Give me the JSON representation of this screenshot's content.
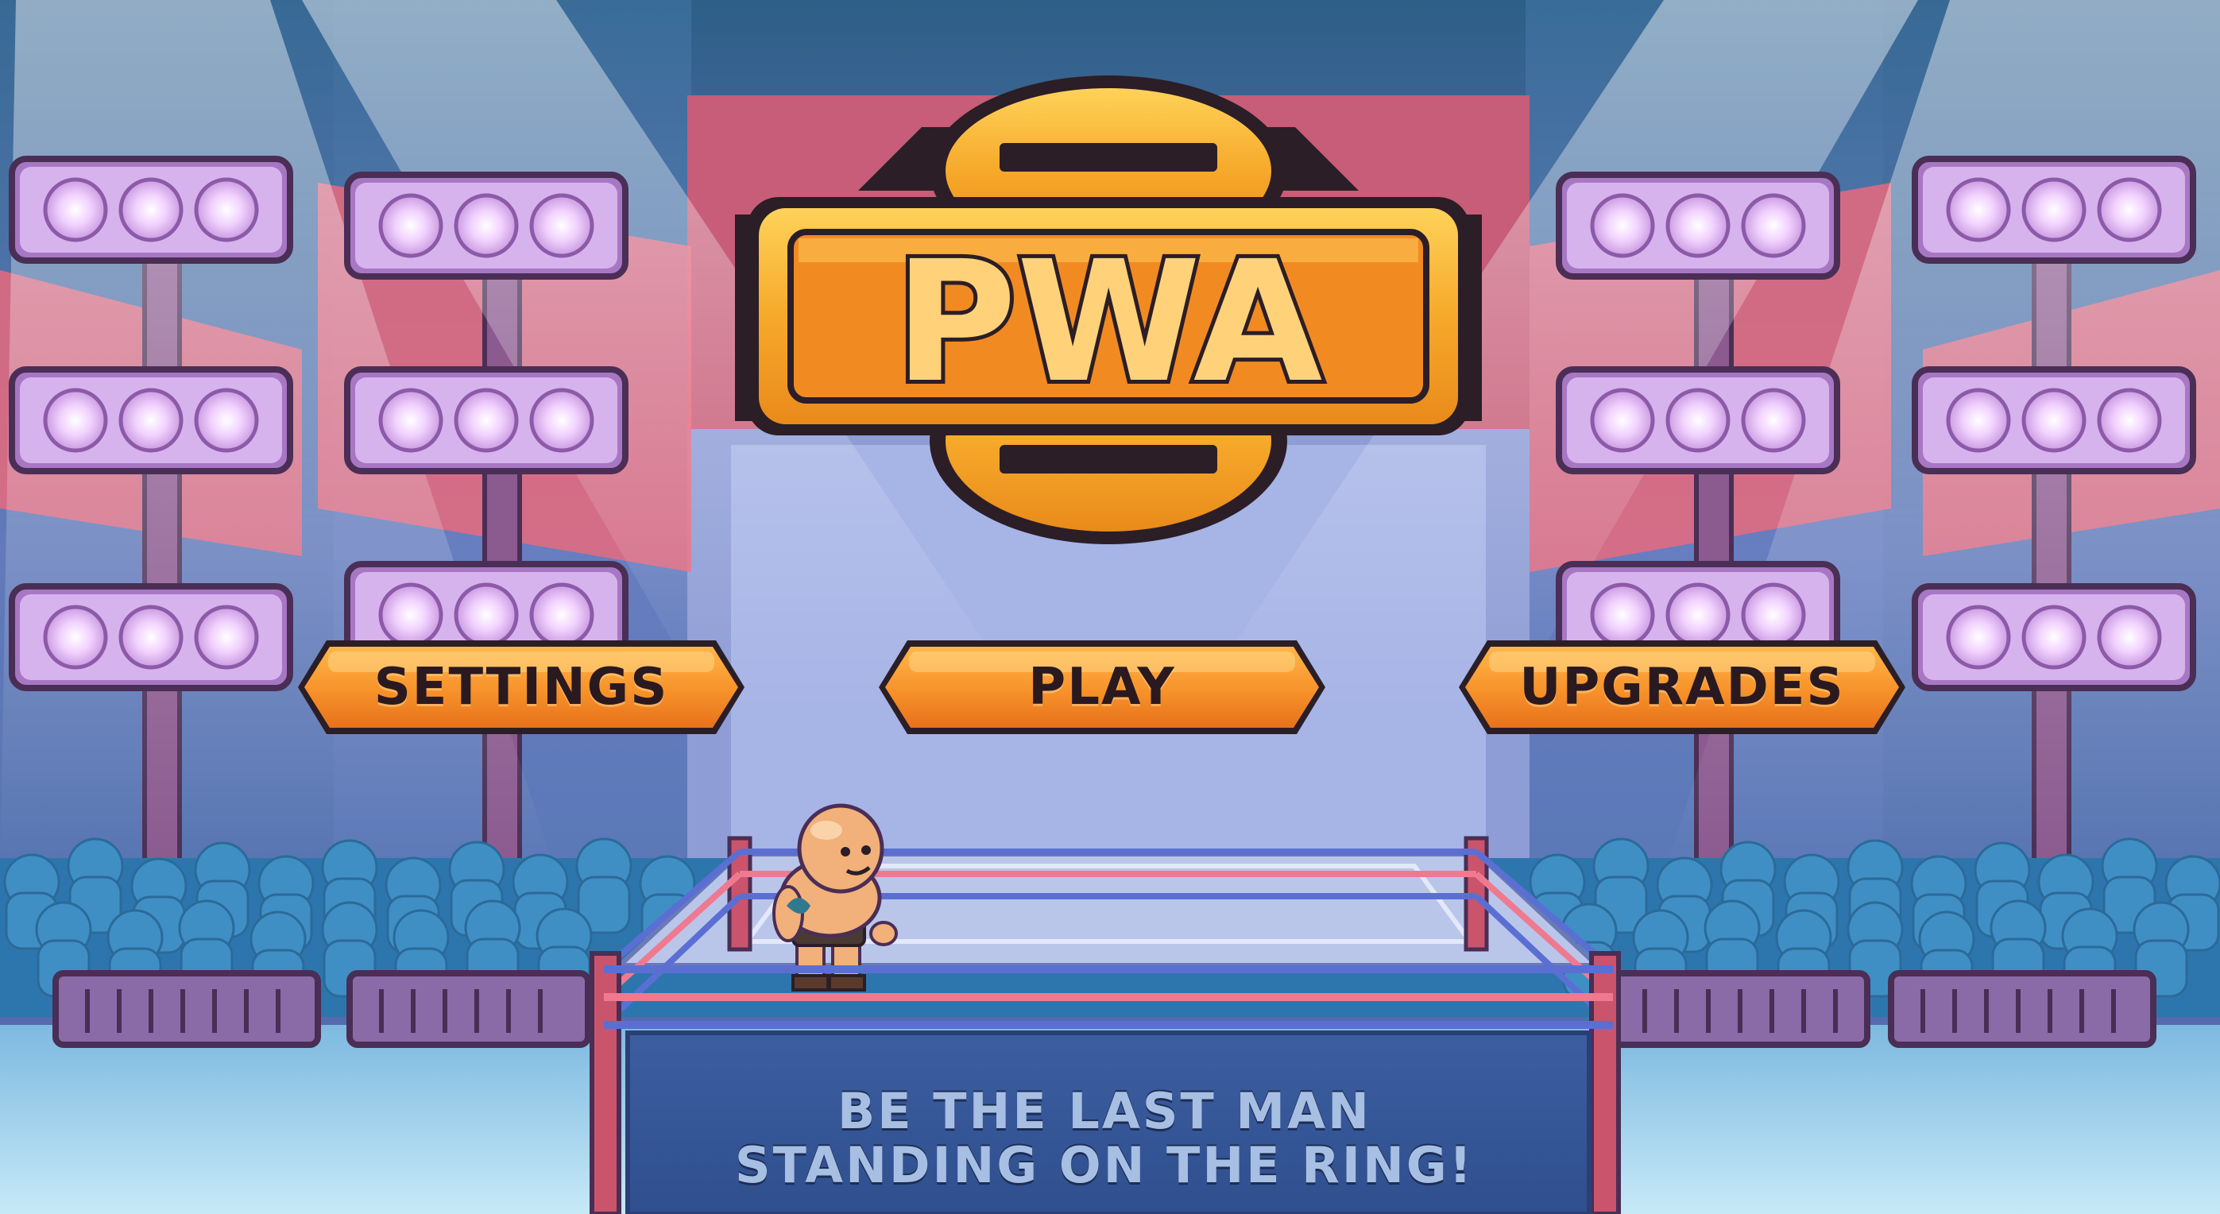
{
  "game": {
    "logo_text": "PWA",
    "tagline_line1": "BE THE LAST MAN",
    "tagline_line2": "STANDING ON THE RING!"
  },
  "menu": {
    "settings_label": "SETTINGS",
    "play_label": "PLAY",
    "upgrades_label": "UPGRADES"
  },
  "colors": {
    "button_fill": "#f7922a",
    "button_outline": "#2b1e26",
    "logo_gold": "#f5b12c",
    "stage_blue": "#5a78b6",
    "light_glow": "#f3d6ff",
    "banner_red": "#e86a7c"
  }
}
